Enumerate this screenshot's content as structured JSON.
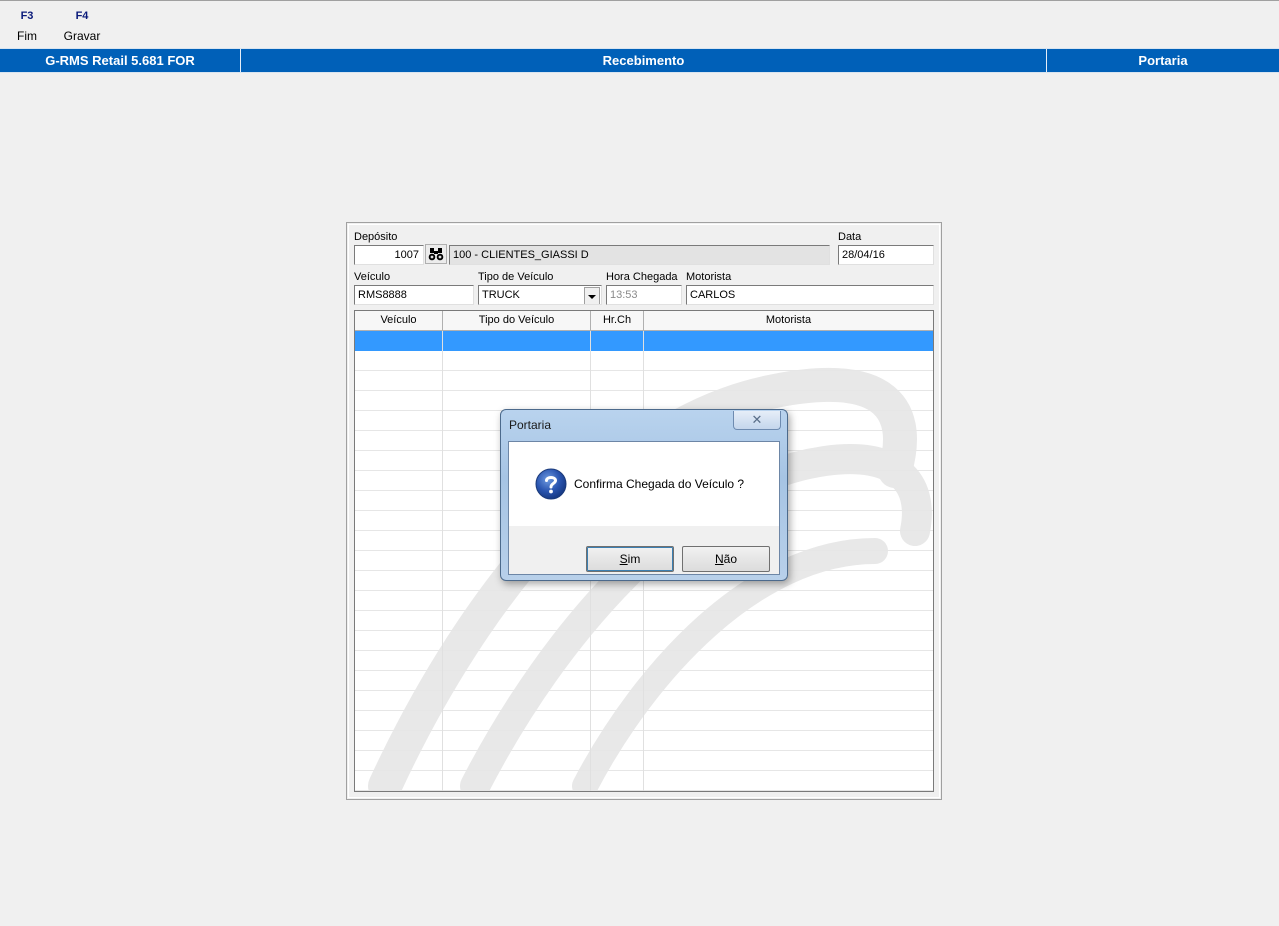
{
  "toolbar": {
    "items": [
      {
        "key": "F3",
        "label": "Fim"
      },
      {
        "key": "F4",
        "label": "Gravar"
      }
    ]
  },
  "titlebar": {
    "app": "G-RMS Retail 5.681 FOR",
    "module": "Recebimento",
    "screen": "Portaria",
    "color": "#0060b8"
  },
  "form": {
    "deposito_label": "Depósito",
    "deposito_code": "1007",
    "deposito_desc": "100 - CLIENTES_GIASSI D",
    "data_label": "Data",
    "data_value": "28/04/16",
    "veiculo_label": "Veículo",
    "veiculo_value": "RMS8888",
    "tipo_label": "Tipo de Veículo",
    "tipo_value": "TRUCK",
    "hora_label": "Hora Chegada",
    "hora_value": "13:53",
    "motorista_label": "Motorista",
    "motorista_value": "CARLOS"
  },
  "grid": {
    "columns": [
      "Veículo",
      "Tipo do Veículo",
      "Hr.Ch",
      "Motorista"
    ],
    "rows": [],
    "selection_color": "#3399ff"
  },
  "dialog": {
    "title": "Portaria",
    "close_glyph": "✕",
    "icon": "question-icon",
    "message": "Confirma Chegada do Veículo ?",
    "yes_key": "S",
    "yes_rest": "im",
    "no_key": "N",
    "no_rest": "ão"
  }
}
